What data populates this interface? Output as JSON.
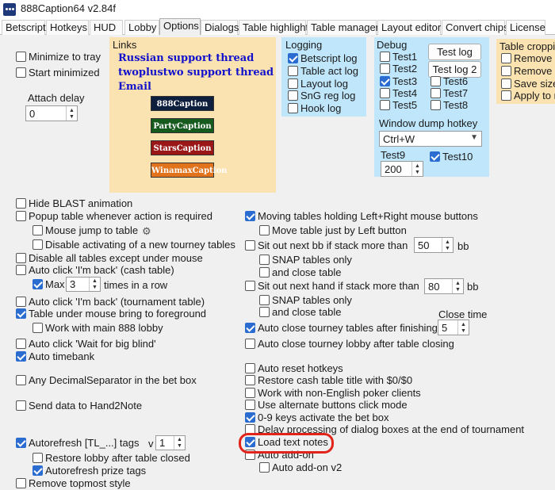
{
  "window": {
    "title": "888Caption64 v2.84f"
  },
  "tabs": [
    "Betscript",
    "Hotkeys",
    "HUD",
    "Lobby",
    "Options",
    "Dialogs",
    "Table highlight",
    "Table manager",
    "Layout editor",
    "Convert chips",
    "License"
  ],
  "active_tab": "Options",
  "left_top": {
    "minimize_to_tray": "Minimize to tray",
    "start_minimized": "Start minimized",
    "attach_delay_label": "Attach delay",
    "attach_delay_value": "0"
  },
  "links": {
    "title": "Links",
    "russian": "Russian support thread",
    "twoplustwo": "twoplustwo support thread",
    "email": "Email",
    "logos": [
      "888Caption",
      "PartyCaption",
      "StarsCaption",
      "WinamaxCaption"
    ]
  },
  "logging": {
    "title": "Logging",
    "items": [
      "Betscript log",
      "Table act log",
      "Layout log",
      "SnG reg log",
      "Hook log"
    ]
  },
  "debug": {
    "title": "Debug",
    "test1": "Test1",
    "test2": "Test2",
    "test3": "Test3",
    "test4": "Test4",
    "test5": "Test5",
    "test6": "Test6",
    "test7": "Test7",
    "test8": "Test8",
    "test_log": "Test log",
    "test_log2": "Test log 2",
    "window_dump_label": "Window dump hotkey",
    "window_dump_value": "Ctrl+W",
    "test9_label": "Test9",
    "test9_value": "200",
    "test10": "Test10"
  },
  "table_cropping": {
    "title": "Table cropping",
    "items": [
      "Remove t",
      "Remove t",
      "Save size",
      "Apply to n"
    ]
  },
  "left_options": {
    "hide_blast": "Hide BLAST animation",
    "popup_table": "Popup table whenever action is required",
    "mouse_jump": "Mouse jump to table",
    "disable_activating": "Disable activating of a new tourney tables",
    "disable_all": "Disable all tables except under mouse",
    "auto_im_back_cash": "Auto click 'I'm back' (cash table)",
    "max_label": "Max",
    "max_value": "3",
    "times_in_row": "times in a row",
    "auto_im_back_tourn": "Auto click 'I'm back' (tournament table)",
    "table_under_mouse": "Table under mouse bring to foreground",
    "work_with_main": "Work with main 888 lobby",
    "auto_wait_bb": "Auto click 'Wait for big blind'",
    "auto_timebank": "Auto timebank",
    "any_decimal": "Any DecimalSeparator in the bet box",
    "send_h2n": "Send data to Hand2Note",
    "autorefresh_tags": "Autorefresh [TL_...] tags",
    "v_label": "v",
    "v_value": "1",
    "restore_lobby": "Restore lobby after table closed",
    "autorefresh_prize": "Autorefresh prize tags",
    "remove_topmost": "Remove topmost style"
  },
  "right_options": {
    "moving_tables": "Moving tables holding Left+Right mouse buttons",
    "move_left": "Move table just by Left button",
    "sit_out_bb": "Sit out next bb if stack more than",
    "sit_out_bb_value": "50",
    "bb": "bb",
    "snap1": "SNAP tables only",
    "close1": "and close table",
    "sit_out_hand": "Sit out next hand if stack more than",
    "sit_out_hand_value": "80",
    "snap2": "SNAP tables only",
    "close2": "and close table",
    "close_time_label": "Close time",
    "close_time_value": "5",
    "auto_close_tourney": "Auto close tourney tables after finishing",
    "auto_close_lobby": "Auto close tourney lobby after table closing",
    "auto_reset_hotkeys": "Auto reset hotkeys",
    "restore_cash_title": "Restore cash table title with $0/$0",
    "non_english": "Work with non-English poker clients",
    "alternate_buttons": "Use alternate buttons click mode",
    "keys_09": "0-9 keys activate the bet box",
    "delay_processing": "Delay processing of dialog boxes at the end of tournament",
    "load_text_notes": "Load text notes",
    "auto_addon": "Auto add-on",
    "auto_addon_v2": "Auto add-on v2"
  },
  "colors": {
    "links_panel": "#fbe3b1",
    "blue_panel": "#bfe6fb",
    "checkbox_on": "#2a6cd0",
    "highlight": "#e2231a"
  }
}
